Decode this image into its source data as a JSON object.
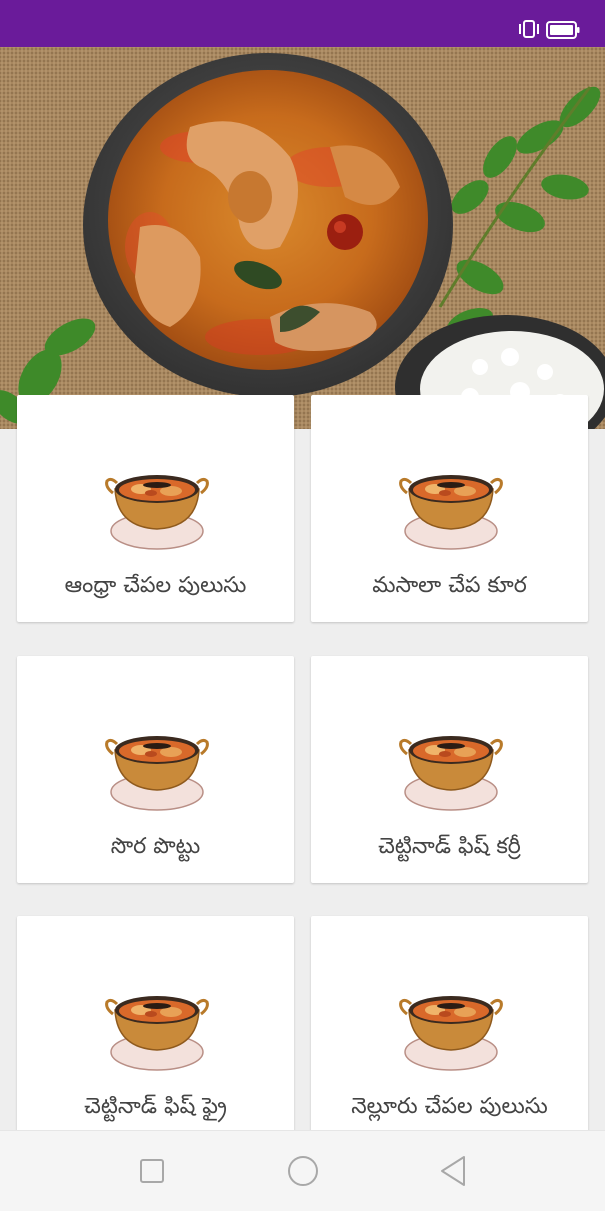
{
  "status_bar": {
    "color": "#6a1b9a",
    "icons": [
      "vibrate-icon",
      "battery-icon"
    ]
  },
  "hero": {
    "image": "fish-curry-bowl-photo"
  },
  "recipes": [
    {
      "label": "ఆంధ్రా చేపల పులుసు",
      "icon": "curry-bowl-icon"
    },
    {
      "label": "మసాలా చేప కూర",
      "icon": "curry-bowl-icon"
    },
    {
      "label": "సొర పొట్టు",
      "icon": "curry-bowl-icon"
    },
    {
      "label": "చెట్టినాడ్ ఫిష్ కర్రీ",
      "icon": "curry-bowl-icon"
    },
    {
      "label": "చెట్టినాడ్ ఫిష్ ఫ్రై",
      "icon": "curry-bowl-icon"
    },
    {
      "label": "నెల్లూరు చేపల పులుసు",
      "icon": "curry-bowl-icon"
    }
  ],
  "nav_bar": {
    "buttons": [
      "recent-apps-icon",
      "home-icon",
      "back-icon"
    ]
  }
}
